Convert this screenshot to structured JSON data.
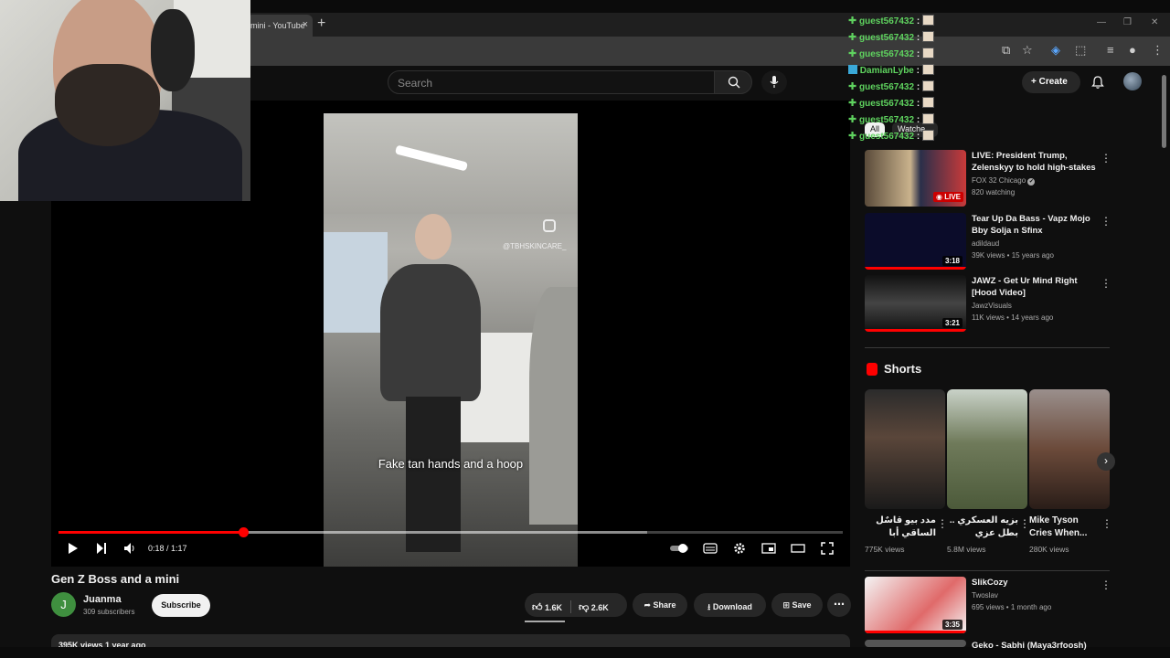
{
  "browser": {
    "tab_title": "mini - YouTube",
    "tab_close": "×",
    "new_tab": "+",
    "win_min": "—",
    "win_max": "❐",
    "win_close": "✕"
  },
  "header": {
    "search_placeholder": "Search",
    "create_label": "Create"
  },
  "video": {
    "ig_handle": "@TBHSKINCARE_",
    "subtitle": "Fake tan hands and a hoop",
    "time": "0:18 / 1:17",
    "progress_fraction": 0.235,
    "buffered_fraction": 0.75,
    "title": "Gen Z Boss and a mini"
  },
  "channel": {
    "avatar_letter": "J",
    "name": "Juanma",
    "subscribers": "309 subscribers",
    "subscribe_label": "Subscribe"
  },
  "actions": {
    "likes": "1.6K",
    "dislikes": "2.6K",
    "share": "Share",
    "download": "Download",
    "save": "Save"
  },
  "description": {
    "stats": "395K views  1 year ago"
  },
  "chat": {
    "lines": [
      {
        "user": "guest567432",
        "color": "#5fd35f"
      },
      {
        "user": "guest567432",
        "color": "#5fd35f"
      },
      {
        "user": "guest567432",
        "color": "#5fd35f"
      },
      {
        "user": "DamianLybe",
        "color": "#5fd35f"
      },
      {
        "user": "guest567432",
        "color": "#5fd35f"
      },
      {
        "user": "guest567432",
        "color": "#5fd35f"
      },
      {
        "user": "guest567432",
        "color": "#5fd35f"
      },
      {
        "user": "guest567432",
        "color": "#5fd35f"
      }
    ],
    "separator": ":"
  },
  "chips": {
    "all": "All",
    "watched": "Watche..."
  },
  "recommendations": [
    {
      "title": "LIVE: President Trump, Zelenskyy to hold high-stakes ...",
      "channel": "FOX 32 Chicago",
      "stats": "820 watching",
      "badge": "LIVE",
      "verified": "✔"
    },
    {
      "title": "Tear Up Da Bass - Vapz Mojo Bby Solja n Sfinx",
      "channel": "adildaud",
      "stats": "39K views • 15 years ago",
      "duration": "3:18"
    },
    {
      "title": "JAWZ - Get Ur Mind Right [Hood Video]",
      "channel": "JawzVisuals",
      "stats": "11K views • 14 years ago",
      "duration": "3:21"
    },
    {
      "title": "SlikCozy",
      "channel": "Twoslav",
      "stats": "695 views • 1 month ago",
      "duration": "3:35"
    },
    {
      "title": "Geko - Sabhi (Maya3rfoosh)",
      "channel": "",
      "stats": ""
    }
  ],
  "shorts": {
    "heading": "Shorts",
    "items": [
      {
        "title": "مدد بيو قاسٌل الساقي أبا الفضل",
        "views": "775K views"
      },
      {
        "title": "بزيه العسكري .. بطل عزي يصافح",
        "views": "5.8M views"
      },
      {
        "title": "Mike Tyson Cries When...",
        "views": "280K views"
      }
    ]
  },
  "colors": {
    "accent": "#ff0000",
    "chat_green": "#5fd35f",
    "background": "#0f0f0f"
  }
}
